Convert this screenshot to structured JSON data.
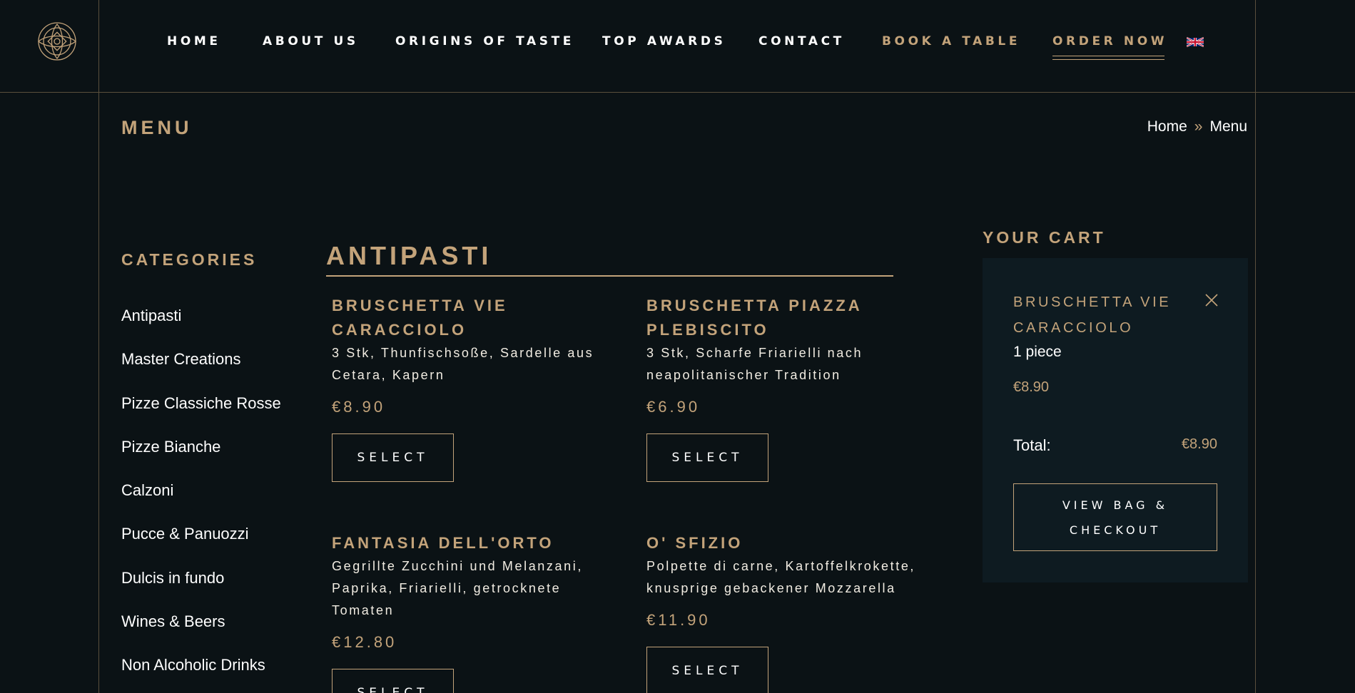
{
  "nav": {
    "items": [
      {
        "label": "HOME"
      },
      {
        "label": "ABOUT US"
      },
      {
        "label": "ORIGINS OF TASTE"
      },
      {
        "label": "TOP AWARDS"
      },
      {
        "label": "CONTACT"
      },
      {
        "label": "BOOK A TABLE"
      },
      {
        "label": "ORDER NOW"
      }
    ],
    "active": "ORDER NOW",
    "language_icon": "uk-flag-icon"
  },
  "page": {
    "title": "MENU",
    "breadcrumb": {
      "home": "Home",
      "separator": "»",
      "current": "Menu"
    }
  },
  "categories": {
    "title": "CATEGORIES",
    "items": [
      "Antipasti",
      "Master Creations",
      "Pizze Classiche Rosse",
      "Pizze Bianche",
      "Calzoni",
      "Pucce & Panuozzi",
      "Dulcis in fundo",
      "Wines & Beers",
      "Non Alcoholic Drinks"
    ]
  },
  "section": {
    "title": "ANTIPASTI",
    "products": [
      {
        "name": "BRUSCHETTA VIE CARACCIOLO",
        "description": "3 Stk, Thunfischsoße, Sardelle aus Cetara, Kapern",
        "price": "€8.90",
        "button": "SELECT"
      },
      {
        "name": "BRUSCHETTA PIAZZA PLEBISCITO",
        "description": "3 Stk, Scharfe Friarielli nach neapolitanischer Tradition",
        "price": "€6.90",
        "button": "SELECT"
      },
      {
        "name": "FANTASIA DELL'ORTO",
        "description": "Gegrillte Zucchini und Melanzani, Paprika, Friarielli, getrocknete Tomaten",
        "price": "€12.80",
        "button": "SELECT"
      },
      {
        "name": "O' SFIZIO",
        "description": "Polpette di carne, Kartoffelkrokette, knusprige gebackener Mozzarella",
        "price": "€11.90",
        "button": "SELECT"
      }
    ]
  },
  "cart": {
    "title": "YOUR CART",
    "item": {
      "name": "BRUSCHETTA VIE CARACCIOLO",
      "quantity": "1 piece",
      "price": "€8.90"
    },
    "total_label": "Total:",
    "total_value": "€8.90",
    "checkout": "VIEW BAG & CHECKOUT"
  },
  "colors": {
    "background": "#0b1215",
    "accent_gold": "#c3a37a",
    "cart_background": "#0e1b21",
    "text": "#f1ece2"
  }
}
